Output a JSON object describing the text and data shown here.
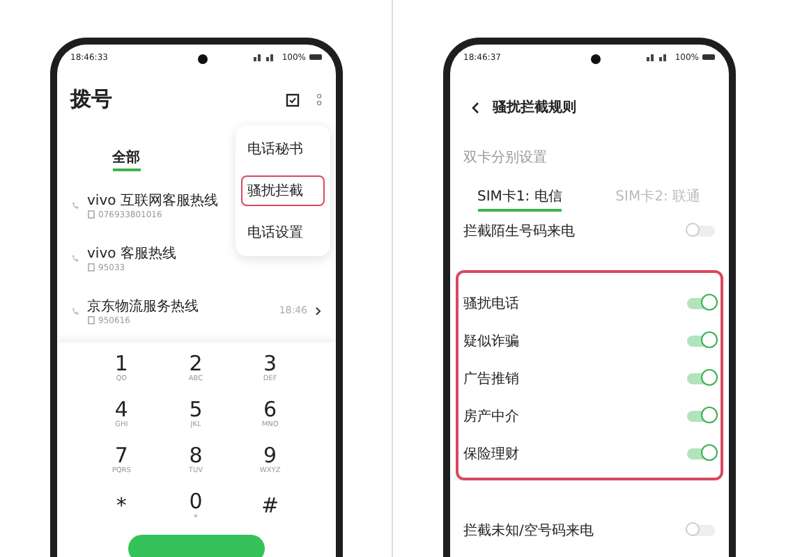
{
  "dialer": {
    "status_bar": {
      "time": "18:46:33",
      "battery": "100%"
    },
    "title": "拨号",
    "tabs": [
      {
        "label": "全部",
        "selected": true
      }
    ],
    "calls": [
      {
        "name": "vivo 互联网客服热线",
        "number": "076933801016"
      },
      {
        "name": "vivo 客服热线",
        "number": "95033"
      },
      {
        "name": "京东物流服务热线",
        "number": "950616",
        "time": "18:46"
      }
    ],
    "menu": [
      {
        "label": "电话秘书",
        "highlighted": false
      },
      {
        "label": "骚扰拦截",
        "highlighted": true
      },
      {
        "label": "电话设置",
        "highlighted": false
      }
    ],
    "keypad": [
      {
        "digit": "1",
        "letters": "QO"
      },
      {
        "digit": "2",
        "letters": "ABC"
      },
      {
        "digit": "3",
        "letters": "DEF"
      },
      {
        "digit": "4",
        "letters": "GHI"
      },
      {
        "digit": "5",
        "letters": "JKL"
      },
      {
        "digit": "6",
        "letters": "MNO"
      },
      {
        "digit": "7",
        "letters": "PQRS"
      },
      {
        "digit": "8",
        "letters": "TUV"
      },
      {
        "digit": "9",
        "letters": "WXYZ"
      },
      {
        "digit": "*"
      },
      {
        "digit": "0",
        "letters": "+"
      },
      {
        "digit": "#"
      }
    ]
  },
  "rules": {
    "status_bar": {
      "time": "18:46:37",
      "battery": "100%"
    },
    "title": "骚扰拦截规则",
    "section_label": "双卡分别设置",
    "sim_tabs": [
      {
        "label": "SIM卡1: 电信",
        "selected": true
      },
      {
        "label": "SIM卡2: 联通",
        "selected": false
      }
    ],
    "settings": [
      {
        "label": "拦截陌生号码来电",
        "on": false,
        "highlighted": false
      },
      {
        "label": "骚扰电话",
        "on": true,
        "highlighted": true
      },
      {
        "label": "疑似诈骗",
        "on": true,
        "highlighted": true
      },
      {
        "label": "广告推销",
        "on": true,
        "highlighted": true
      },
      {
        "label": "房产中介",
        "on": true,
        "highlighted": true
      },
      {
        "label": "保险理财",
        "on": true,
        "highlighted": true
      },
      {
        "label": "拦截未知/空号码来电",
        "on": false,
        "highlighted": false
      }
    ]
  }
}
